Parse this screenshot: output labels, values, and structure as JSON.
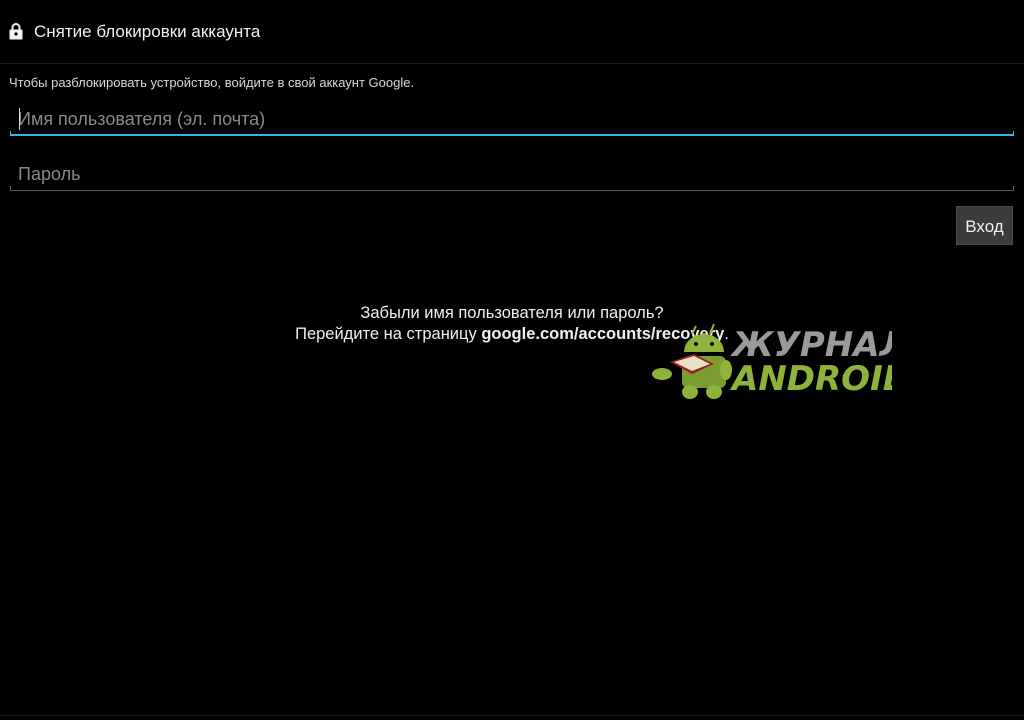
{
  "header": {
    "title": "Снятие блокировки аккаунта",
    "icon": "lock-icon"
  },
  "instruction": "Чтобы разблокировать устройство, войдите в свой аккаунт Google.",
  "form": {
    "username": {
      "value": "",
      "placeholder": "Имя пользователя (эл. почта)",
      "focused": true
    },
    "password": {
      "value": "",
      "placeholder": "Пароль"
    },
    "submit_label": "Вход"
  },
  "help": {
    "line1": "Забыли имя пользователя или пароль?",
    "line2_prefix": "Перейдите на страницу ",
    "line2_link": "google.com/accounts/recovery",
    "line2_suffix": "."
  },
  "watermark": {
    "line1": "ЖУРНАЛ",
    "line2": "ANDROID",
    "icon": "android-reading-icon"
  },
  "colors": {
    "background": "#000000",
    "accent": "#33b5e5",
    "watermark_green": "#8db33a"
  }
}
